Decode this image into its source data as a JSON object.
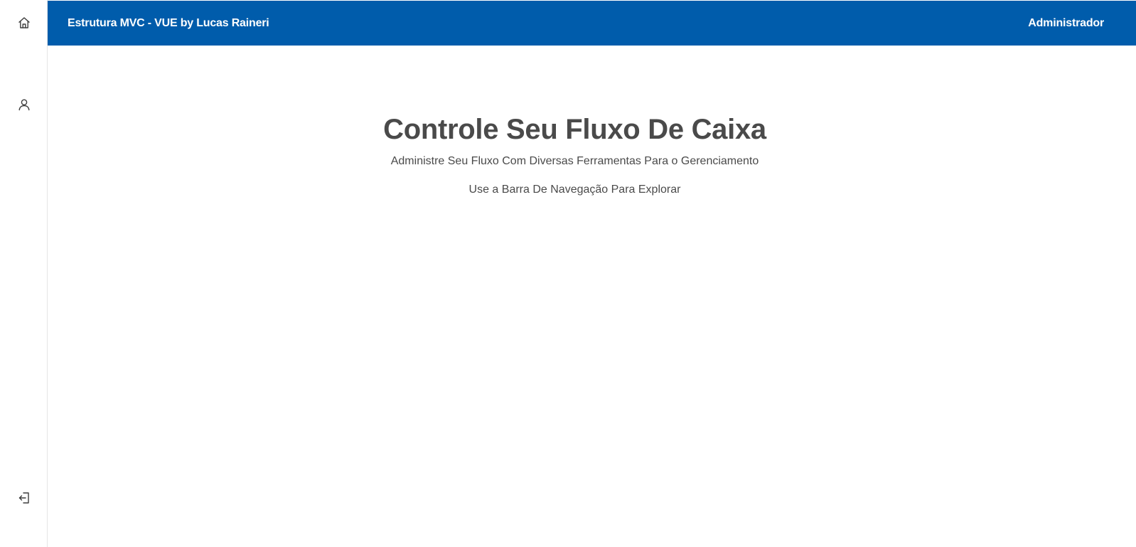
{
  "topbar": {
    "brand": "Estrutura MVC - VUE by Lucas Raineri",
    "user": "Administrador",
    "background": "#005cab"
  },
  "sidebar": {
    "items": [
      {
        "icon": "home-icon",
        "name": "home"
      },
      {
        "icon": "user-icon",
        "name": "profile"
      },
      {
        "icon": "logout-icon",
        "name": "logout"
      }
    ]
  },
  "main": {
    "title": "Controle Seu Fluxo De Caixa",
    "subtitle": "Administre Seu Fluxo Com Diversas Ferramentas Para o Gerenciamento",
    "hint": "Use a Barra De Navegação Para Explorar"
  }
}
